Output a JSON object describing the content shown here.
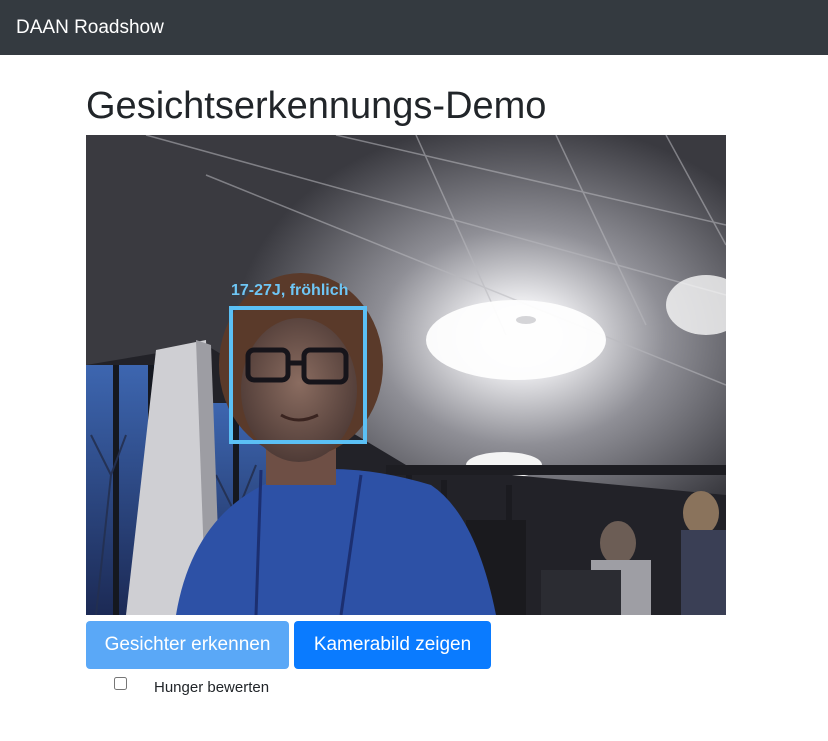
{
  "navbar": {
    "brand": "DAAN Roadshow"
  },
  "page": {
    "title": "Gesichtserkennungs-Demo"
  },
  "camera": {
    "detection": {
      "label": "17-27J, fröhlich",
      "box_color": "#5bc0f5"
    }
  },
  "controls": {
    "detect_button_label": "Gesichter erkennen",
    "camera_button_label": "Kamerabild zeigen",
    "hunger_checkbox": {
      "label": "Hunger bewerten",
      "checked": false
    }
  },
  "colors": {
    "navbar_bg": "#343a40",
    "detect_button_bg": "#5aa8f7",
    "camera_button_bg": "#0a7bff",
    "detection_box": "#5bc0f5"
  }
}
